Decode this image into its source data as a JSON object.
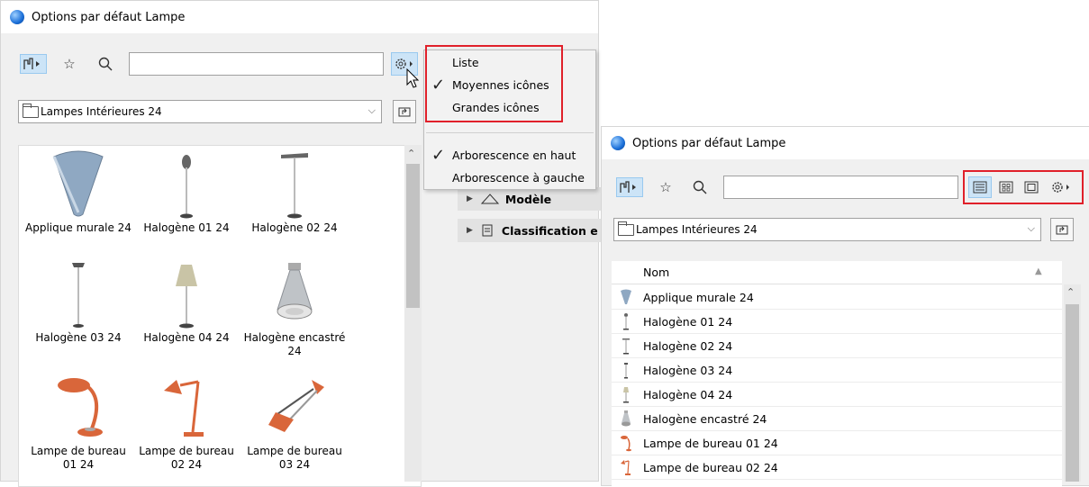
{
  "left_window": {
    "title": "Options par défaut Lampe",
    "folder": "Lampes Intérieures 24",
    "items": [
      {
        "label": "Applique murale 24"
      },
      {
        "label": "Halogène 01 24"
      },
      {
        "label": "Halogène 02 24"
      },
      {
        "label": "Halogène 03 24"
      },
      {
        "label": "Halogène 04 24"
      },
      {
        "label": "Halogène encastré 24"
      },
      {
        "label": "Lampe de bureau 01 24"
      },
      {
        "label": "Lampe de bureau 02 24"
      },
      {
        "label": "Lampe de bureau 03 24"
      }
    ],
    "tree": [
      {
        "label": "Modèle"
      },
      {
        "label": "Classification e"
      }
    ]
  },
  "menu": {
    "items": [
      {
        "label": "Liste",
        "checked": false
      },
      {
        "label": "Moyennes icônes",
        "checked": true
      },
      {
        "label": "Grandes icônes",
        "checked": false
      },
      {
        "label": "Arborescence en haut",
        "checked": true
      },
      {
        "label": "Arborescence à gauche",
        "checked": false
      }
    ]
  },
  "right_window": {
    "title": "Options par défaut Lampe",
    "folder": "Lampes Intérieures 24",
    "column_header": "Nom",
    "rows": [
      {
        "label": "Applique murale 24"
      },
      {
        "label": "Halogène 01 24"
      },
      {
        "label": "Halogène 02 24"
      },
      {
        "label": "Halogène 03 24"
      },
      {
        "label": "Halogène 04 24"
      },
      {
        "label": "Halogène encastré 24"
      },
      {
        "label": "Lampe de bureau 01 24"
      },
      {
        "label": "Lampe de bureau 02 24"
      }
    ]
  },
  "colors": {
    "highlight": "#e0202a",
    "lamp_orange": "#d9663a",
    "selection": "#cce4f7"
  }
}
